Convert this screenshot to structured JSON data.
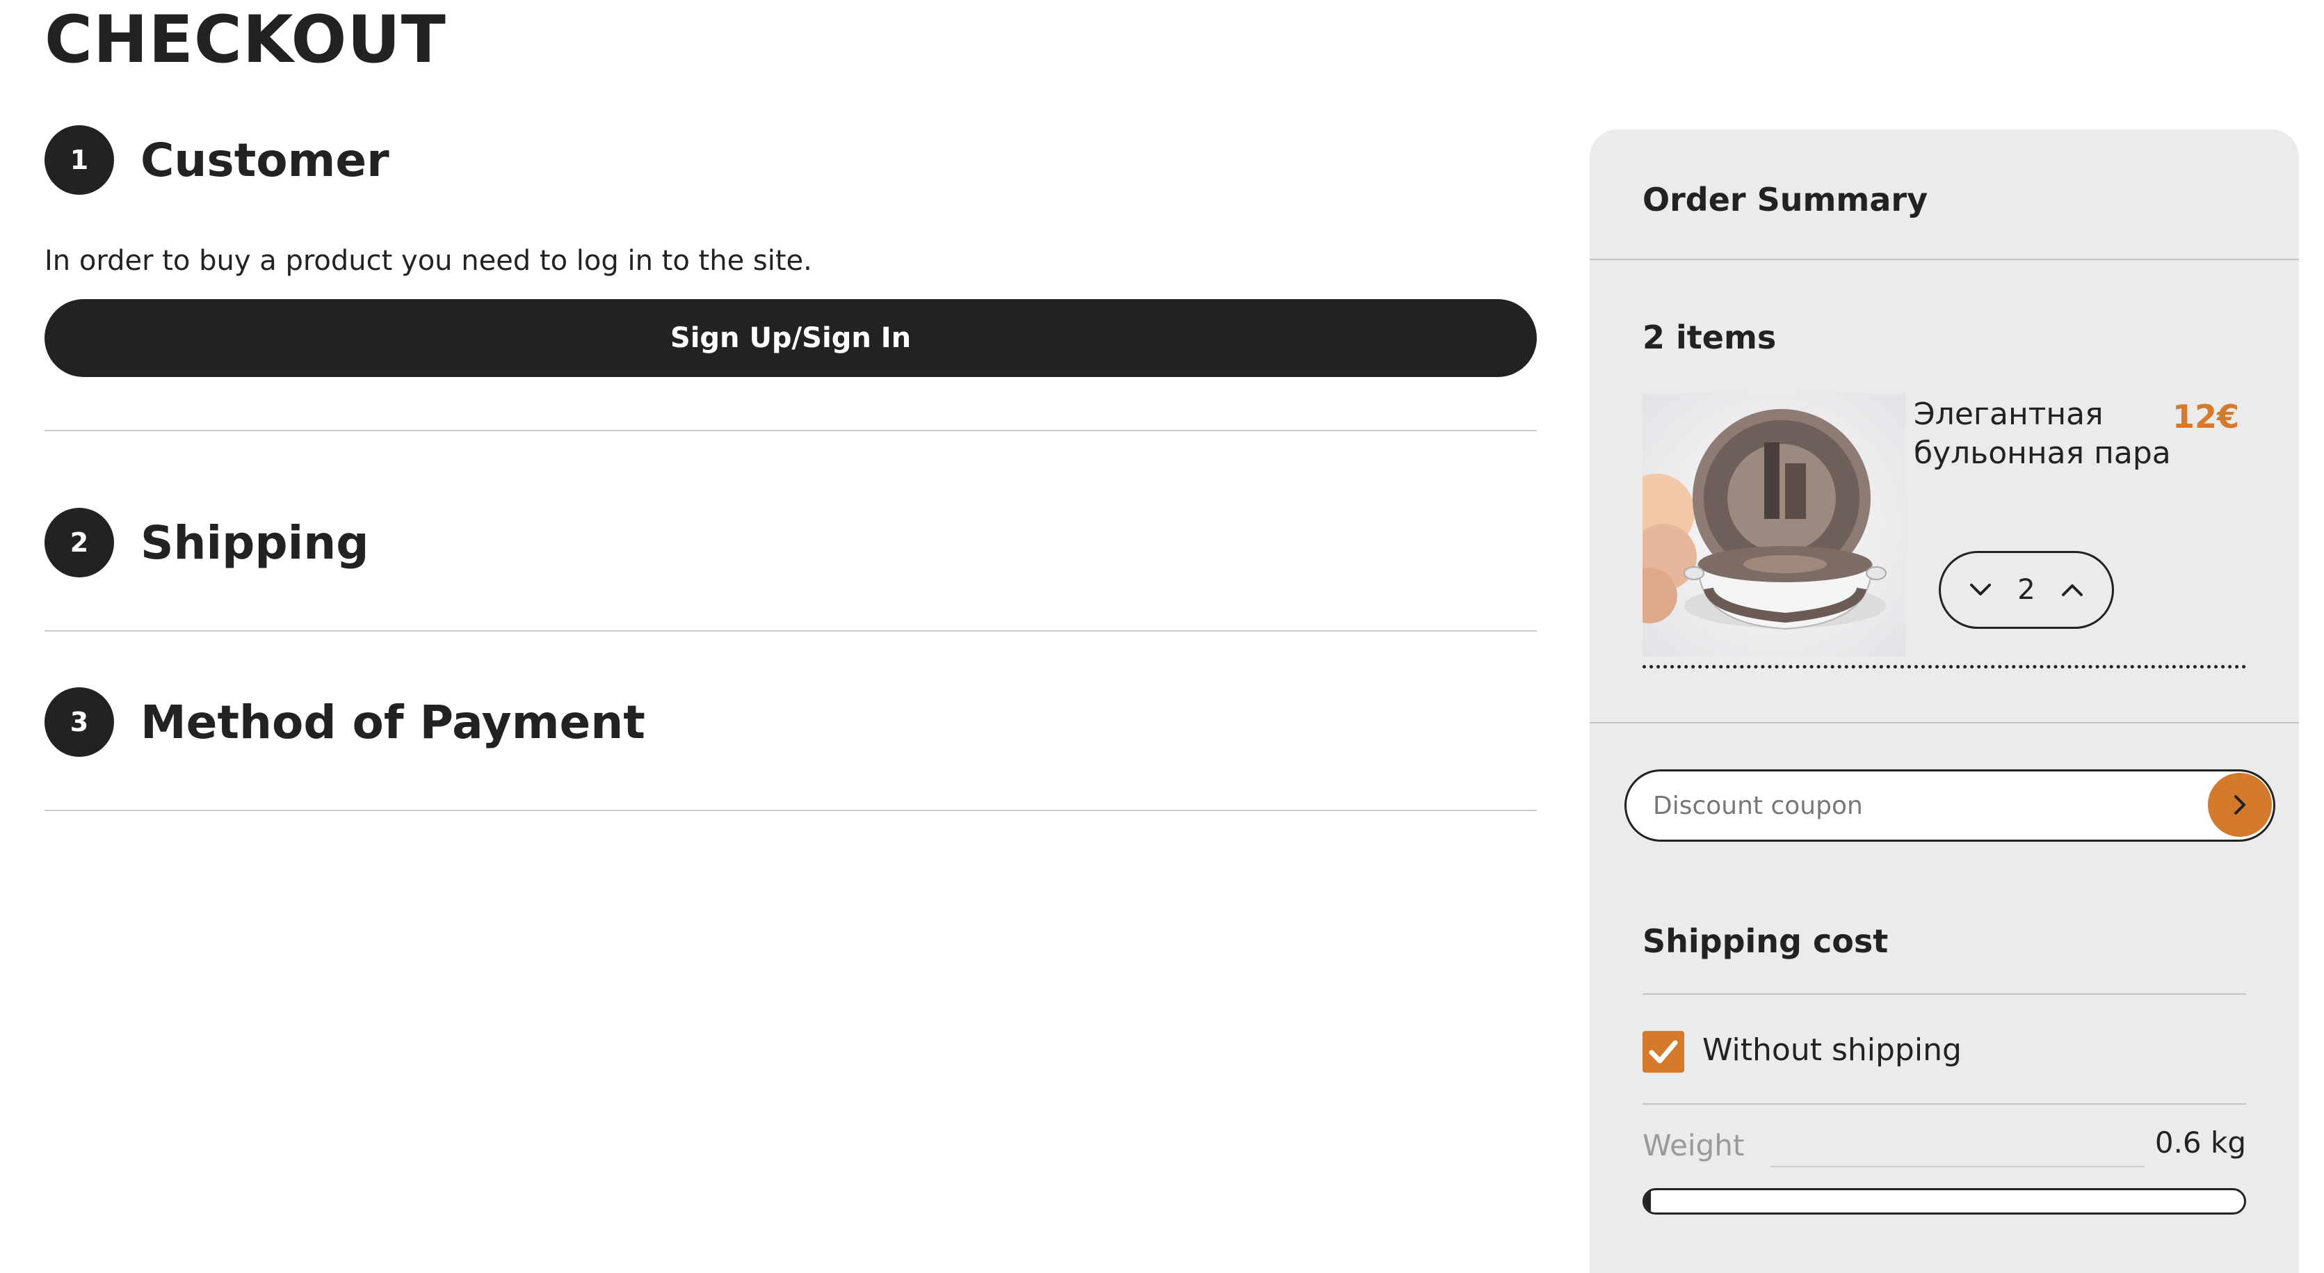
{
  "page": {
    "title": "CHECKOUT"
  },
  "steps": [
    {
      "number": "1",
      "title": "Customer",
      "text": "In order to buy a product you need to log in to the site.",
      "button_label": "Sign Up/Sign In"
    },
    {
      "number": "2",
      "title": "Shipping"
    },
    {
      "number": "3",
      "title": "Method of Payment"
    }
  ],
  "summary": {
    "title": "Order Summary",
    "items_count": "2 items",
    "product": {
      "name": "Элегантная бульонная пара",
      "price": "12€",
      "quantity": "2"
    },
    "coupon": {
      "placeholder": "Discount coupon"
    },
    "shipping": {
      "title": "Shipping cost",
      "option_label": "Without shipping",
      "option_checked": true,
      "weight_label": "Weight",
      "weight_value": "0.6 kg",
      "weight_progress_percent": 1
    }
  },
  "colors": {
    "accent": "#d37a2c",
    "dark": "#222222",
    "panel": "#ebebeb"
  },
  "icons": [
    "chevron-down-icon",
    "chevron-up-icon",
    "chevron-right-icon",
    "checkmark-icon"
  ]
}
